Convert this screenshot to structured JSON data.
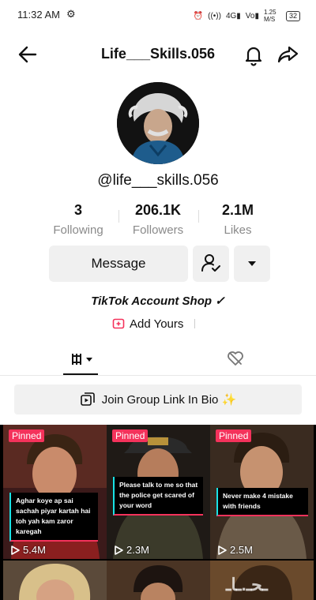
{
  "status_bar": {
    "time": "11:32 AM",
    "speed": "1.25 M/S",
    "battery": "32"
  },
  "header": {
    "title": "Life___Skills.056"
  },
  "profile": {
    "handle": "@life___skills.056",
    "stats": [
      {
        "value": "3",
        "label": "Following"
      },
      {
        "value": "206.1K",
        "label": "Followers"
      },
      {
        "value": "2.1M",
        "label": "Likes"
      }
    ],
    "message_label": "Message",
    "bio": "TikTok Account Shop ✓",
    "add_yours_label": "Add Yours"
  },
  "banner": {
    "label": "Join Group Link In Bio ✨"
  },
  "videos": [
    {
      "badge": "Pinned",
      "caption": "Aghar koye ap sai sachah piyar kartah hai toh yah kam zaror karegah",
      "views": "5.4M"
    },
    {
      "badge": "Pinned",
      "caption": "Please talk to me so that the police get scared of your word",
      "views": "2.3M"
    },
    {
      "badge": "Pinned",
      "caption": "Never make 4 mistake with friends",
      "views": "2.5M"
    }
  ],
  "icons": {
    "back": "arrow-left-icon",
    "bell": "bell-icon",
    "share": "share-arrow-icon",
    "follow": "person-check-icon",
    "more": "triangle-down-icon",
    "grid_tab": "grid-icon",
    "liked_tab": "heart-hidden-icon",
    "banner": "group-link-icon",
    "play": "play-icon"
  },
  "colors": {
    "accent": "#f4325b",
    "caption_border": "#19e3e6"
  }
}
